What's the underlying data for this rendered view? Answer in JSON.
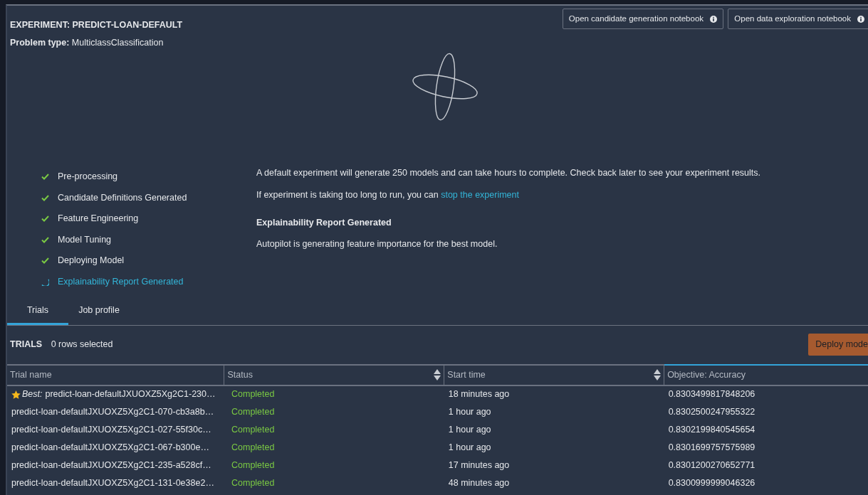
{
  "experiment": {
    "title": "EXPERIMENT: PREDICT-LOAN-DEFAULT",
    "problem_label": "Problem type:",
    "problem_value": "MulticlassClassification"
  },
  "header_buttons": [
    {
      "label": "Open candidate generation notebook"
    },
    {
      "label": "Open data exploration notebook"
    }
  ],
  "steps": [
    {
      "label": "Pre-processing",
      "kind": "done"
    },
    {
      "label": "Candidate Definitions Generated",
      "kind": "done"
    },
    {
      "label": "Feature Engineering",
      "kind": "done"
    },
    {
      "label": "Model Tuning",
      "kind": "done"
    },
    {
      "label": "Deploying Model",
      "kind": "done"
    },
    {
      "label": "Explainability Report Generated",
      "kind": "running"
    }
  ],
  "info": {
    "message": "A default experiment will generate 250 models and can take hours to complete. Check back later to see your experiment results.",
    "stop_text": "If experiment is taking too long to run, you can",
    "stop_link": "stop the experiment",
    "report_title": "Explainability Report Generated",
    "report_text": "Autopilot is generating feature importance for the best model."
  },
  "tabs": [
    {
      "label": "Trials",
      "selected": true
    },
    {
      "label": "Job profile",
      "selected": false
    }
  ],
  "trials": {
    "title": "TRIALS",
    "selection": "0 rows selected",
    "deploy_button": "Deploy mode",
    "columns": [
      {
        "label": "Trial name",
        "sortable": false,
        "highlighted": false
      },
      {
        "label": "Status",
        "sortable": true,
        "highlighted": false
      },
      {
        "label": "Start time",
        "sortable": true,
        "highlighted": false
      },
      {
        "label": "Objective: Accuracy",
        "sortable": false,
        "highlighted": true
      }
    ],
    "rows": [
      {
        "best": true,
        "best_label": "Best:",
        "name": "predict-loan-defaultJXUOXZ5Xg2C1-230…",
        "status": "Completed",
        "start": "18 minutes ago",
        "accuracy": "0.8303499817848206"
      },
      {
        "best": false,
        "name": "predict-loan-defaultJXUOXZ5Xg2C1-070-cb3a8b…",
        "status": "Completed",
        "start": "1 hour ago",
        "accuracy": "0.8302500247955322"
      },
      {
        "best": false,
        "name": "predict-loan-defaultJXUOXZ5Xg2C1-027-55f30c…",
        "status": "Completed",
        "start": "1 hour ago",
        "accuracy": "0.8302199840545654"
      },
      {
        "best": false,
        "name": "predict-loan-defaultJXUOXZ5Xg2C1-067-b300e…",
        "status": "Completed",
        "start": "1 hour ago",
        "accuracy": "0.8301699757575989"
      },
      {
        "best": false,
        "name": "predict-loan-defaultJXUOXZ5Xg2C1-235-a528cf…",
        "status": "Completed",
        "start": "17 minutes ago",
        "accuracy": "0.8301200270652771"
      },
      {
        "best": false,
        "name": "predict-loan-defaultJXUOXZ5Xg2C1-131-0e38e2…",
        "status": "Completed",
        "start": "48 minutes ago",
        "accuracy": "0.8300999999046326"
      }
    ]
  }
}
